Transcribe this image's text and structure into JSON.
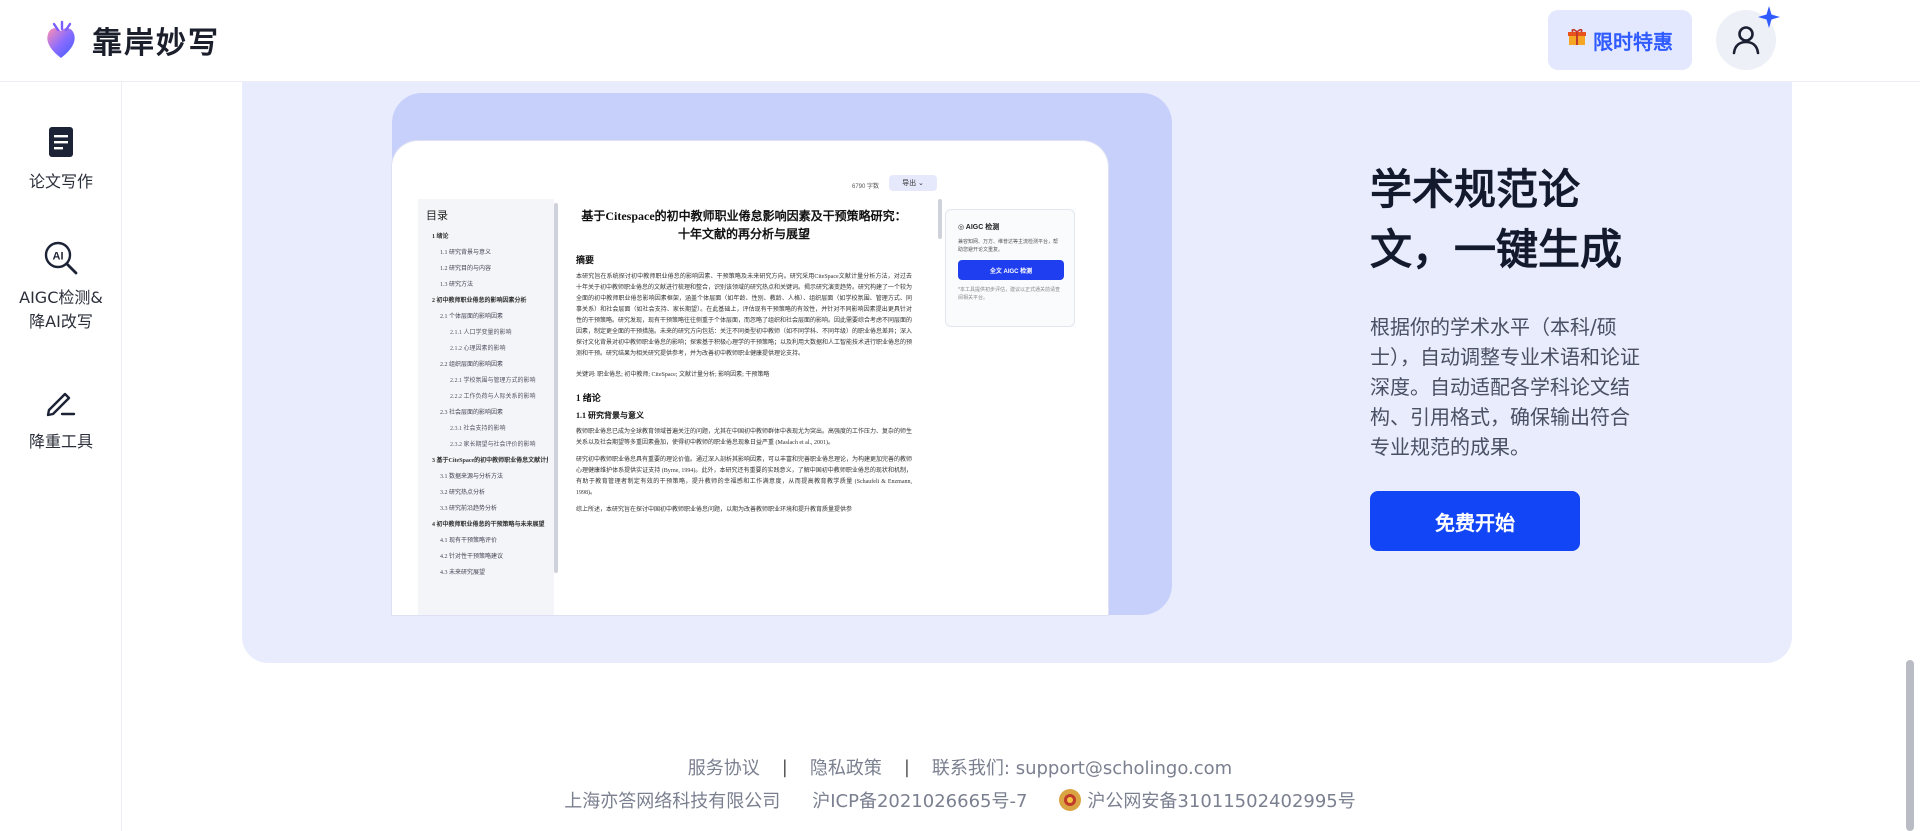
{
  "brand": {
    "name": "靠岸妙写",
    "accent": "#1245f5"
  },
  "header": {
    "promo_label": "限时特惠",
    "promo_icon": "gift-icon",
    "avatar_icon": "user-icon"
  },
  "sidebar": {
    "items": [
      {
        "label": "论文写作",
        "icon": "document-icon"
      },
      {
        "label_line1": "AIGC检测&",
        "label_line2": "降AI改写",
        "icon": "ai-search-icon"
      },
      {
        "label": "降重工具",
        "icon": "pen-icon"
      }
    ]
  },
  "preview": {
    "wordcount": "6790 字数",
    "export_label": "导出",
    "toc_title": "目录",
    "toc": [
      {
        "level": 1,
        "text": "1 绪论"
      },
      {
        "level": 2,
        "text": "1.1 研究背景与意义"
      },
      {
        "level": 2,
        "text": "1.2 研究目的与内容"
      },
      {
        "level": 2,
        "text": "1.3 研究方法"
      },
      {
        "level": 1,
        "text": "2 初中教师职业倦怠的影响因素分析"
      },
      {
        "level": 2,
        "text": "2.1 个体层面的影响因素"
      },
      {
        "level": 3,
        "text": "2.1.1 人口学变量的影响"
      },
      {
        "level": 3,
        "text": "2.1.2 心理因素的影响"
      },
      {
        "level": 2,
        "text": "2.2 组织层面的影响因素"
      },
      {
        "level": 3,
        "text": "2.2.1 学校氛围与管理方式的影响"
      },
      {
        "level": 3,
        "text": "2.2.2 工作负荷与人际关系的影响"
      },
      {
        "level": 2,
        "text": "2.3 社会层面的影响因素"
      },
      {
        "level": 3,
        "text": "2.3.1 社会支持的影响"
      },
      {
        "level": 3,
        "text": "2.3.2 家长期望与社会评价的影响"
      },
      {
        "level": 1,
        "text": "3 基于CiteSpace的初中教师职业倦怠文献计量分析"
      },
      {
        "level": 2,
        "text": "3.1 数据来源与分析方法"
      },
      {
        "level": 2,
        "text": "3.2 研究热点分析"
      },
      {
        "level": 2,
        "text": "3.3 研究前沿趋势分析"
      },
      {
        "level": 1,
        "text": "4 初中教师职业倦怠的干预策略与未来展望"
      },
      {
        "level": 2,
        "text": "4.1 现有干预策略评价"
      },
      {
        "level": 2,
        "text": "4.2 针对性干预策略建议"
      },
      {
        "level": 2,
        "text": "4.3 未来研究展望"
      }
    ],
    "doc_title": "基于Citespace的初中教师职业倦怠影响因素及干预策略研究：十年文献的再分析与展望",
    "abstract_heading": "摘要",
    "abstract": "本研究旨在系统探讨初中教师职业倦怠的影响因素、干预策略及未来研究方向。研究采用CiteSpace文献计量分析方法，对过去十年关于初中教师职业倦怠的文献进行梳理和整合，识别该领域的研究热点和关键词。揭示研究演变趋势。研究构建了一个较为全面的初中教师职业倦怠影响因素框架，涵盖个体层面（如年龄、性别、教龄、人格）、组织层面（如学校氛围、管理方式、同事关系）和社会层面（如社会支持、家长期望）。在此基础上，评估现有干预策略的有效性，并针对不同影响因素提出更具针对性的干预策略。研究发现，现有干预策略往往侧重于个体层面，而忽略了组织和社会层面的影响。因此需要综合考虑不同层面的因素，制定更全面的干预措施。未来的研究方向包括：关注不同类型初中教师（如不同学科、不同年级）的职业倦怠差异；深入探讨文化背景对初中教师职业倦怠的影响；探索基于积极心理学的干预策略；以及利用大数据和人工智能技术进行职业倦怠的预测和干预。研究结果为相关研究提供参考，并为改善初中教师职业健康提供理论支持。",
    "keywords": "关键词: 职业倦怠; 初中教师; CiteSpace; 文献计量分析; 影响因素; 干预策略",
    "section1": "1 绪论",
    "section11": "1.1 研究背景与意义",
    "para1": "教师职业倦怠已成为全球教育领域普遍关注的问题，尤其在中国初中教师群体中表现尤为突出。高强度的工作压力、复杂的师生关系以及社会期望等多重因素叠加，使得初中教师的职业倦怠现象日益严重 (Maslach et al., 2001)。",
    "para2": "研究初中教师职业倦怠具有重要的理论价值。通过深入剖析其影响因素，可以丰富和完善职业倦怠理论，为构建更加完善的教师心理健康维护体系提供实证支持 (Byrne, 1994)。此外，本研究还有重要的实践意义，了解中国初中教师职业倦怠的现状和机制，有助于教育管理者制定有效的干预策略，提升教师的幸福感和工作满意度，从而提高教育教学质量 (Schaufeli & Enzmann, 1998)。",
    "para3": "综上所述，本研究旨在探讨中国初中教师职业倦怠问题，以期为改善教师职业环境和提升教育质量提供参",
    "aigc_title": "AIGC 检测",
    "aigc_desc": "兼容知网、万方、维普达等主流检测平台，帮助您避开论文重复。",
    "aigc_button": "全文 AIGC 检测",
    "aigc_note": "*本工具提供初步评估，建议以正式通关前请查阅相关平台。"
  },
  "hero": {
    "headline": "学术规范论文，一键生成",
    "description": "根据你的学术水平（本科/硕士），自动调整专业术语和论证深度。自动适配各学科论文结构、引用格式，确保输出符合专业规范的成果。",
    "cta": "免费开始"
  },
  "footer": {
    "terms": "服务协议",
    "privacy": "隐私政策",
    "contact": "联系我们: support@scholingo.com",
    "company": "上海亦答网络科技有限公司",
    "icp": "沪ICP备2021026665号-7",
    "police": "沪公网安备31011502402995号"
  }
}
